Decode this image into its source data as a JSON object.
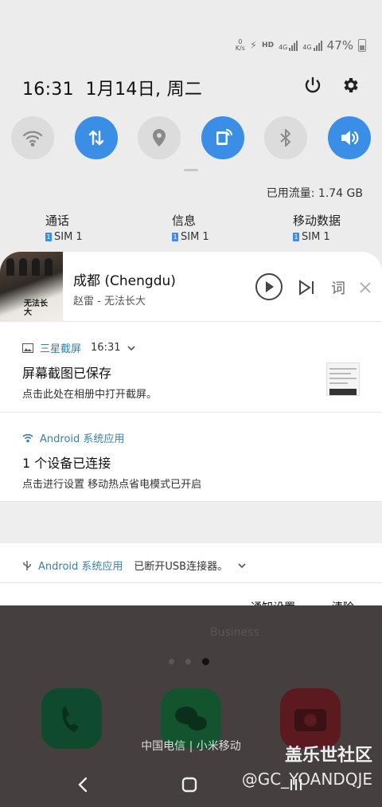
{
  "status_bar": {
    "speed_value": "0",
    "speed_unit": "K/s",
    "hd_label": "HD",
    "net1_label": "4G",
    "net2_label": "4G",
    "battery_percent": "47%"
  },
  "header": {
    "time": "16:31",
    "date": "1月14日, 周二"
  },
  "quick_settings": [
    {
      "name": "wifi",
      "icon": "wifi-icon",
      "active": false
    },
    {
      "name": "mobile-data",
      "icon": "arrows-updown-icon",
      "active": true
    },
    {
      "name": "location",
      "icon": "location-pin-icon",
      "active": false
    },
    {
      "name": "hotspot",
      "icon": "hotspot-icon",
      "active": true
    },
    {
      "name": "bluetooth",
      "icon": "bluetooth-icon",
      "active": false
    },
    {
      "name": "sound",
      "icon": "speaker-icon",
      "active": true
    }
  ],
  "data_usage": "已用流量: 1.74 GB",
  "sim_settings": [
    {
      "label": "通话",
      "sim": "SIM 1"
    },
    {
      "label": "信息",
      "sim": "SIM 1"
    },
    {
      "label": "移动数据",
      "sim": "SIM 1"
    }
  ],
  "media": {
    "title": "成都 (Chengdu)",
    "artist": "赵雷 - 无法长大",
    "album_text": "无法长大",
    "lyrics_label": "词"
  },
  "notifications": [
    {
      "app": "三星截屏",
      "time": "16:31",
      "title": "屏幕截图已保存",
      "body": "点击此处在相册中打开截屏。"
    },
    {
      "app": "Android 系统应用",
      "title": "1 个设备已连接",
      "body": "点击进行设置 移动热点省电模式已开启"
    },
    {
      "app": "Android 系统应用",
      "text": "已断开USB连接器。"
    }
  ],
  "actions": {
    "settings": "通知设置",
    "clear": "清除"
  },
  "home": {
    "folder_label": "Business",
    "carrier": "中国电信 | 小米移动"
  },
  "watermark": {
    "line1": "盖乐世社区",
    "line2": "@GC_YOANDQJE"
  },
  "colors": {
    "accent": "#3a8ee6",
    "app_label": "#3a7fa4"
  }
}
